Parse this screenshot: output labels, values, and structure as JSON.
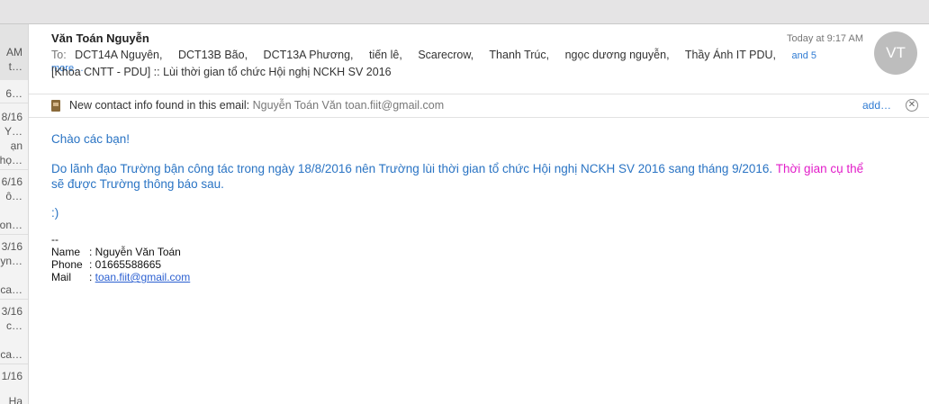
{
  "list_fragments": [
    {
      "text": "AM",
      "top": 0
    },
    {
      "text": "t…",
      "top": 0
    },
    {
      "text": "6…",
      "top": 0
    },
    {
      "text": "8/16",
      "top": 0
    },
    {
      "text": "Y…",
      "top": 0
    },
    {
      "text": "ạn",
      "top": 0
    },
    {
      "text": "họ…",
      "top": 0
    },
    {
      "text": "6/16",
      "top": 0
    },
    {
      "text": "ô…",
      "top": 0
    },
    {
      "text": "on…",
      "top": 0
    },
    {
      "text": "3/16",
      "top": 0
    },
    {
      "text": "yn…",
      "top": 0
    },
    {
      "text": "ca…",
      "top": 0
    },
    {
      "text": "3/16",
      "top": 0
    },
    {
      "text": "c…",
      "top": 0
    },
    {
      "text": "ca…",
      "top": 0
    },
    {
      "text": "1/16",
      "top": 0
    },
    {
      "text": "Ha",
      "top": 0
    }
  ],
  "message": {
    "sender": "Văn Toán Nguyễn",
    "time": "Today at 9:17 AM",
    "avatar_initials": "VT",
    "to_label": "To:",
    "recipients": [
      "DCT14A Nguyên,",
      "DCT13B Bão,",
      "DCT13A Phương,",
      "tiến lê,",
      "Scarecrow,",
      "Thanh Trúc,",
      "ngọc dương nguyễn,",
      "Thầy Ánh IT PDU,"
    ],
    "more_label": "and 5 more…",
    "subject": "[Khoa CNTT - PDU] :: Lùi thời gian tổ chức Hội nghị NCKH SV 2016"
  },
  "contact_bar": {
    "text": "New contact info found in this email:",
    "detail": "Nguyễn Toán Văn toan.fiit@gmail.com",
    "add_label": "add…",
    "close_glyph": "✕"
  },
  "body": {
    "greeting": "Chào các bạn!",
    "para1_blue": "Do lãnh đạo Trường bận công tác trong ngày 18/8/2016 nên Trường lùi thời gian tổ chức Hội nghị NCKH SV 2016 sang tháng 9/2016.",
    "para1_magenta": "Thời gian cụ thể",
    "para1_blue2": "sẽ được Trường thông báo sau.",
    "smiley": ":)"
  },
  "signature": {
    "dashes": "--",
    "name_label": "Name",
    "name_value": ": Nguyễn Văn Toán",
    "phone_label": "Phone",
    "phone_value": ": 01665588665",
    "mail_label": "Mail",
    "mail_colon": ": ",
    "mail_value": "toan.fiit@gmail.com"
  },
  "colors": {
    "body_text": "#2a74c4",
    "highlight": "#e21ec9",
    "link": "#2f7bd3"
  }
}
